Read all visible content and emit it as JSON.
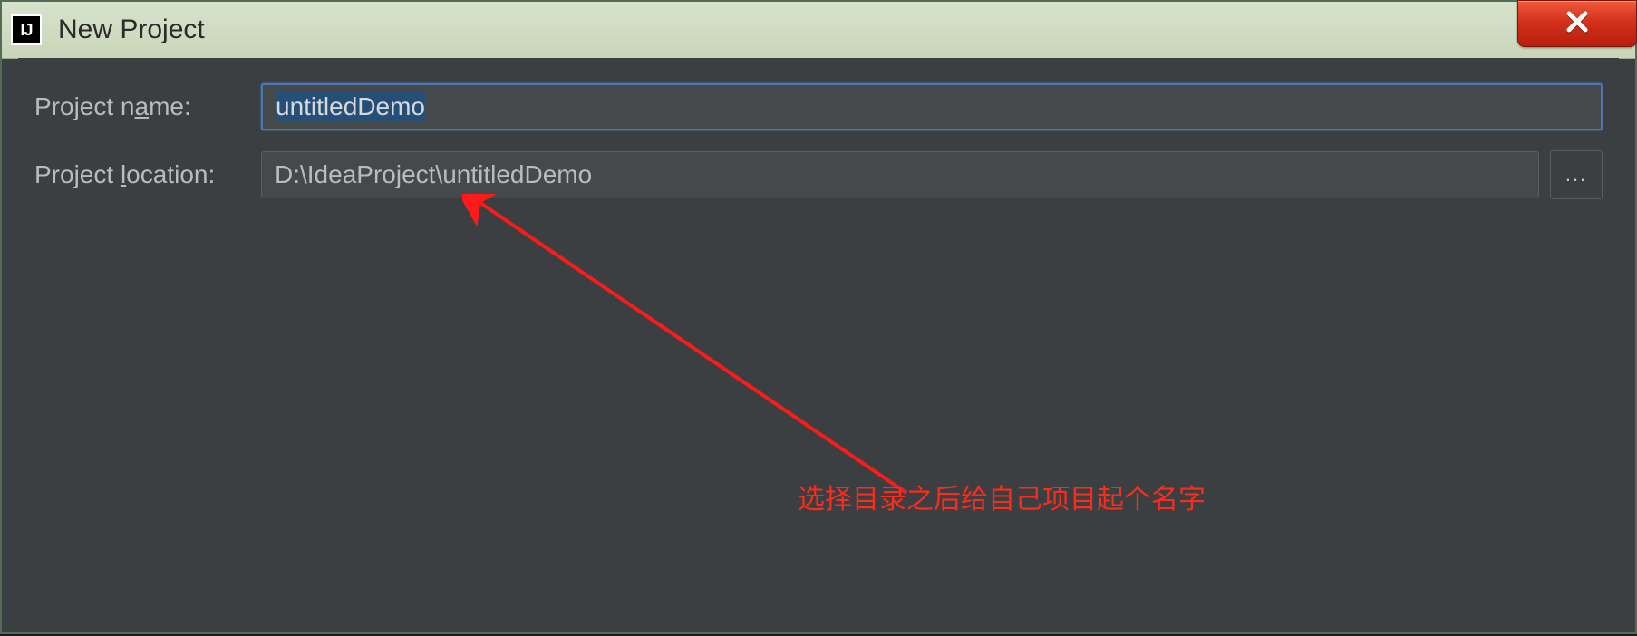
{
  "window": {
    "title": "New Project",
    "app_icon_text": "IJ"
  },
  "form": {
    "name_label_pre": "Project n",
    "name_label_mn": "a",
    "name_label_post": "me:",
    "name_value": "untitledDemo",
    "location_label_pre": "Project ",
    "location_label_mn": "l",
    "location_label_post": "ocation:",
    "location_value": "D:\\IdeaProject\\untitledDemo",
    "browse_label": "..."
  },
  "annotation": {
    "text": "选择目录之后给自己项目起个名字"
  }
}
